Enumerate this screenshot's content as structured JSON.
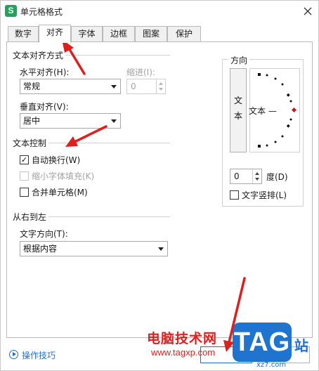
{
  "window": {
    "title": "单元格格式",
    "app_icon_letter": "S"
  },
  "tabs": [
    {
      "label": "数字",
      "active": false
    },
    {
      "label": "对齐",
      "active": true
    },
    {
      "label": "字体",
      "active": false
    },
    {
      "label": "边框",
      "active": false
    },
    {
      "label": "图案",
      "active": false
    },
    {
      "label": "保护",
      "active": false
    }
  ],
  "alignment": {
    "section_title": "文本对齐方式",
    "horizontal_label": "水平对齐(H):",
    "horizontal_value": "常规",
    "indent_label": "缩进(I):",
    "indent_value": "0",
    "vertical_label": "垂直对齐(V):",
    "vertical_value": "居中"
  },
  "text_control": {
    "section_title": "文本控制",
    "wrap_text": {
      "label": "自动换行(W)",
      "checked": true,
      "mark": "✓"
    },
    "shrink_to_fit": {
      "label": "缩小字体填充(K)",
      "checked": false,
      "disabled": true
    },
    "merge_cells": {
      "label": "合并单元格(M)",
      "checked": false
    }
  },
  "rtl": {
    "section_title": "从右到左",
    "direction_label": "文字方向(T):",
    "direction_value": "根据内容"
  },
  "orientation": {
    "section_title": "方向",
    "vertical_text_chars": [
      "文",
      "本"
    ],
    "dial_text": "文本 —",
    "degree_value": "0",
    "degree_label": "度(D)",
    "vertical_stack_label": "文字竖排(L)"
  },
  "footer": {
    "tips_label": "操作技巧"
  },
  "watermark": {
    "site_name": "电脑技术网",
    "url": "www.tagxp.com",
    "logo": "TAG",
    "suffix": "站",
    "sub": "xz7.com"
  },
  "colors": {
    "accent": "#1e70c4",
    "annotation_arrow": "#e11d1d",
    "logo_bg": "#1e74cf",
    "app_icon": "#22a25b"
  }
}
